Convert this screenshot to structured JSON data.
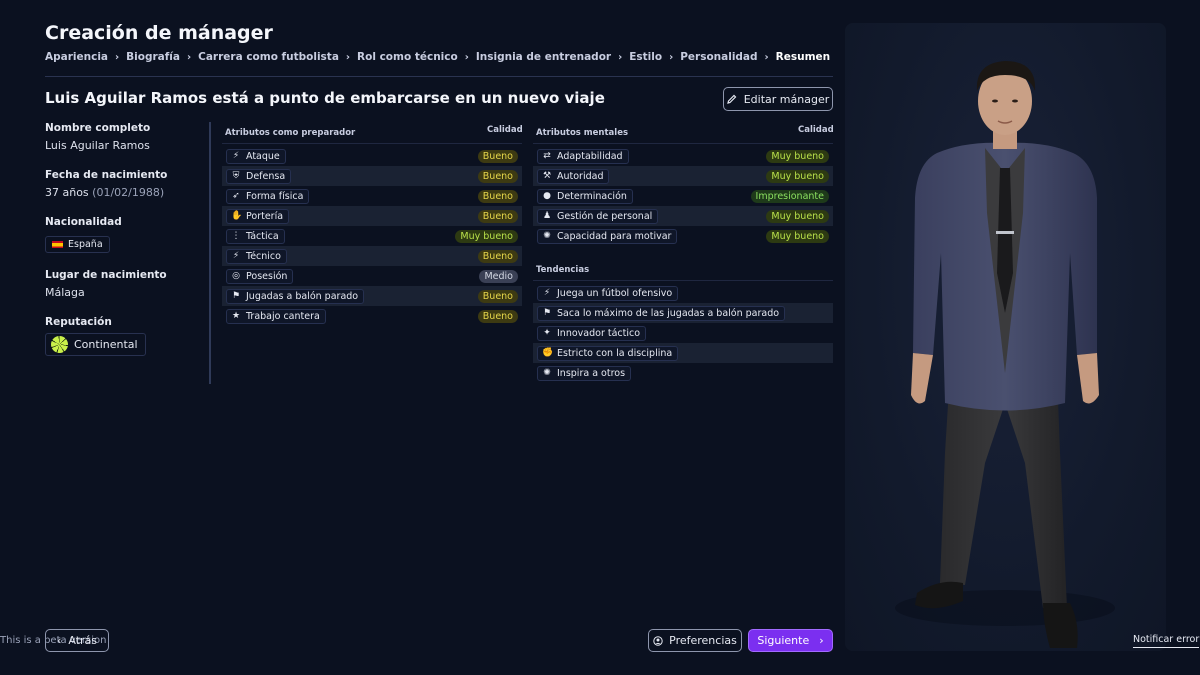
{
  "header": {
    "title": "Creación de mánager",
    "breadcrumb": [
      "Apariencia",
      "Biografía",
      "Carrera como futbolista",
      "Rol como técnico",
      "Insignia de entrenador",
      "Estilo",
      "Personalidad",
      "Resumen"
    ],
    "active_crumb_index": 7
  },
  "summary": {
    "headline": "Luis Aguilar Ramos está a punto de embarcarse en un nuevo viaje",
    "edit_label": "Editar mánager"
  },
  "profile": {
    "full_name_label": "Nombre completo",
    "full_name": "Luis Aguilar Ramos",
    "birth_label": "Fecha de nacimiento",
    "age": "37 años",
    "birth_date": "(01/02/1988)",
    "nationality_label": "Nacionalidad",
    "nationality": "España",
    "birthplace_label": "Lugar de nacimiento",
    "birthplace": "Málaga",
    "reputation_label": "Reputación",
    "reputation": "Continental"
  },
  "coaching": {
    "heading": "Atributos como preparador",
    "quality_heading": "Calidad",
    "items": [
      {
        "label": "Ataque",
        "icon": "attack-icon",
        "glyph": "⚡",
        "quality": "Bueno",
        "level": "bueno"
      },
      {
        "label": "Defensa",
        "icon": "defense-icon",
        "glyph": "⛨",
        "quality": "Bueno",
        "level": "bueno"
      },
      {
        "label": "Forma física",
        "icon": "fitness-icon",
        "glyph": "➶",
        "quality": "Bueno",
        "level": "bueno"
      },
      {
        "label": "Portería",
        "icon": "goalkeeping-icon",
        "glyph": "✋",
        "quality": "Bueno",
        "level": "bueno"
      },
      {
        "label": "Táctica",
        "icon": "tactics-icon",
        "glyph": "⋮",
        "quality": "Muy bueno",
        "level": "muy"
      },
      {
        "label": "Técnico",
        "icon": "technical-icon",
        "glyph": "⚡",
        "quality": "Bueno",
        "level": "bueno"
      },
      {
        "label": "Posesión",
        "icon": "possession-icon",
        "glyph": "◎",
        "quality": "Medio",
        "level": "medio"
      },
      {
        "label": "Jugadas a balón parado",
        "icon": "set-pieces-icon",
        "glyph": "⚑",
        "quality": "Bueno",
        "level": "bueno"
      },
      {
        "label": "Trabajo cantera",
        "icon": "youth-icon",
        "glyph": "★",
        "quality": "Bueno",
        "level": "bueno"
      }
    ]
  },
  "mental": {
    "heading": "Atributos mentales",
    "quality_heading": "Calidad",
    "items": [
      {
        "label": "Adaptabilidad",
        "icon": "adaptability-icon",
        "glyph": "⇄",
        "quality": "Muy bueno",
        "level": "muy"
      },
      {
        "label": "Autoridad",
        "icon": "authority-icon",
        "glyph": "⚒",
        "quality": "Muy bueno",
        "level": "muy"
      },
      {
        "label": "Determinación",
        "icon": "determination-icon",
        "glyph": "●",
        "quality": "Impresionante",
        "level": "imp"
      },
      {
        "label": "Gestión de personal",
        "icon": "people-management-icon",
        "glyph": "♟",
        "quality": "Muy bueno",
        "level": "muy"
      },
      {
        "label": "Capacidad para motivar",
        "icon": "motivation-icon",
        "glyph": "✺",
        "quality": "Muy bueno",
        "level": "muy"
      }
    ]
  },
  "tendencies": {
    "heading": "Tendencias",
    "items": [
      {
        "label": "Juega un fútbol ofensivo",
        "icon": "attack-icon",
        "glyph": "⚡"
      },
      {
        "label": "Saca lo máximo de las jugadas a balón parado",
        "icon": "set-pieces-icon",
        "glyph": "⚑"
      },
      {
        "label": "Innovador táctico",
        "icon": "innovation-icon",
        "glyph": "✦"
      },
      {
        "label": "Estricto con la disciplina",
        "icon": "discipline-icon",
        "glyph": "✊"
      },
      {
        "label": "Inspira a otros",
        "icon": "inspire-icon",
        "glyph": "✺"
      }
    ]
  },
  "footer": {
    "back_label": "Atrás",
    "beta_text": "This is a beta version",
    "preferences_label": "Preferencias",
    "next_label": "Siguiente",
    "notify_label": "Notificar error"
  },
  "colors": {
    "background": "#0b1120",
    "accent": "#7b2ff0",
    "bueno": "#e6d64a",
    "muy_bueno": "#b9e04a",
    "impresionante": "#8be060"
  }
}
